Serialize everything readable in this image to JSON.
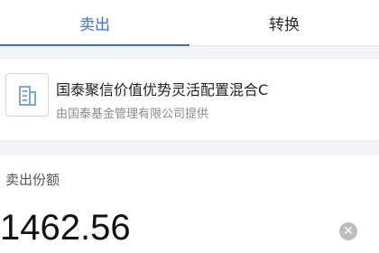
{
  "tabs": [
    {
      "label": "卖出",
      "active": true
    },
    {
      "label": "转换",
      "active": false
    }
  ],
  "fund": {
    "name": "国泰聚信价值优势灵活配置混合C",
    "provider": "由国泰基金管理有限公司提供",
    "logo_icon": "building-icon"
  },
  "sell": {
    "label": "卖出份额",
    "amount": "1462.56"
  },
  "colors": {
    "accent": "#3a6fd8",
    "background": "#f2f3f5"
  }
}
